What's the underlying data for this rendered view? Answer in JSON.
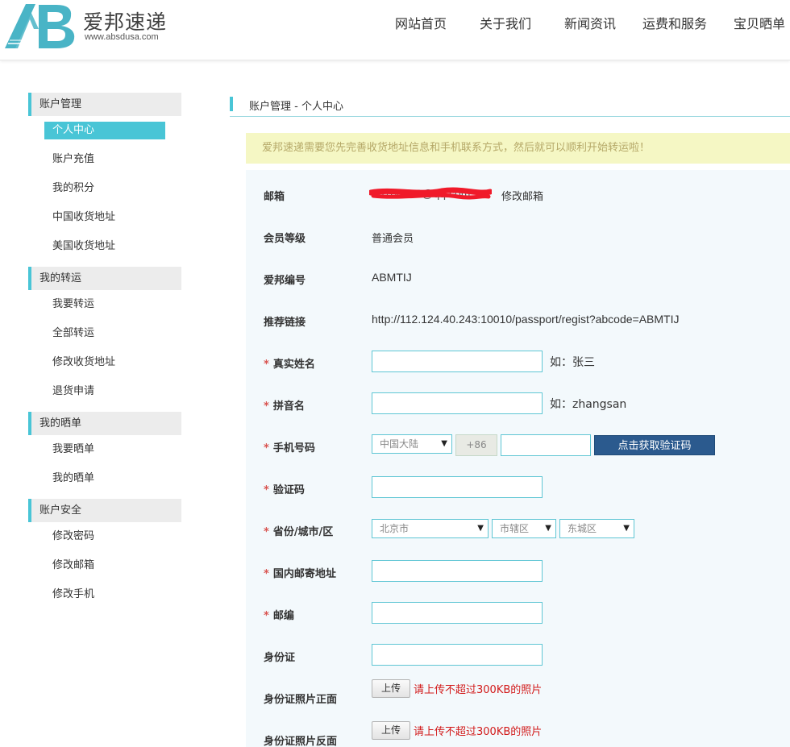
{
  "header": {
    "brand_name": "爱邦速递",
    "brand_url": "www.absdusa.com",
    "nav": [
      {
        "label": "网站首页"
      },
      {
        "label": "关于我们"
      },
      {
        "label": "新闻资讯"
      },
      {
        "label": "运费和服务"
      },
      {
        "label": "宝贝晒单"
      }
    ]
  },
  "sidebar": {
    "groups": [
      {
        "title": "账户管理",
        "items": [
          "个人中心",
          "账户充值",
          "我的积分",
          "中国收货地址",
          "美国收货地址"
        ]
      },
      {
        "title": "我的转运",
        "items": [
          "我要转运",
          "全部转运",
          "修改收货地址",
          "退货申请"
        ]
      },
      {
        "title": "我的晒单",
        "items": [
          "我要晒单",
          "我的晒单"
        ]
      },
      {
        "title": "账户安全",
        "items": [
          "修改密码",
          "修改邮箱",
          "修改手机"
        ]
      }
    ],
    "active_item": "个人中心"
  },
  "main": {
    "title": "账户管理 - 个人中心",
    "notice": "爱邦速递需要您先完善收货地址信息和手机联系方式，然后就可以顺利开始转运啦！",
    "email": {
      "label": "邮箱",
      "value": "18700013@qq.com",
      "change_link": "修改邮箱"
    },
    "member_level": {
      "label": "会员等级",
      "value": "普通会员"
    },
    "member_id": {
      "label": "爱邦编号",
      "value": "ABMTIJ"
    },
    "referral": {
      "label": "推荐链接",
      "value": "http://112.124.40.243:10010/passport/regist?abcode=ABMTIJ"
    },
    "real_name": {
      "label": "真实姓名",
      "required": "*",
      "value": "",
      "hint": "如：张三"
    },
    "pinyin_name": {
      "label": "拼音名",
      "required": "*",
      "value": "",
      "hint": "如：zhangsan"
    },
    "phone": {
      "label": "手机号码",
      "required": "*",
      "country": "中国大陆",
      "code": "+86",
      "value": "",
      "get_code_button": "点击获取验证码"
    },
    "verify_code": {
      "label": "验证码",
      "required": "*",
      "value": ""
    },
    "region": {
      "label": "省份/城市/区",
      "required": "*",
      "province": "北京市",
      "city": "市辖区",
      "district": "东城区"
    },
    "address": {
      "label": "国内邮寄地址",
      "required": "*",
      "value": ""
    },
    "postcode": {
      "label": "邮编",
      "required": "*",
      "value": ""
    },
    "id_card": {
      "label": "身份证",
      "value": ""
    },
    "id_front": {
      "label": "身份证照片正面",
      "button": "上传",
      "hint": "请上传不超过300KB的照片"
    },
    "id_back": {
      "label": "身份证照片反面",
      "button": "上传",
      "hint": "请上传不超过300KB的照片"
    }
  },
  "colors": {
    "accent": "#49c5d6",
    "button_blue": "#2b5a8e",
    "notice_bg": "#f5f7c4",
    "error_red": "#d21a1a"
  }
}
